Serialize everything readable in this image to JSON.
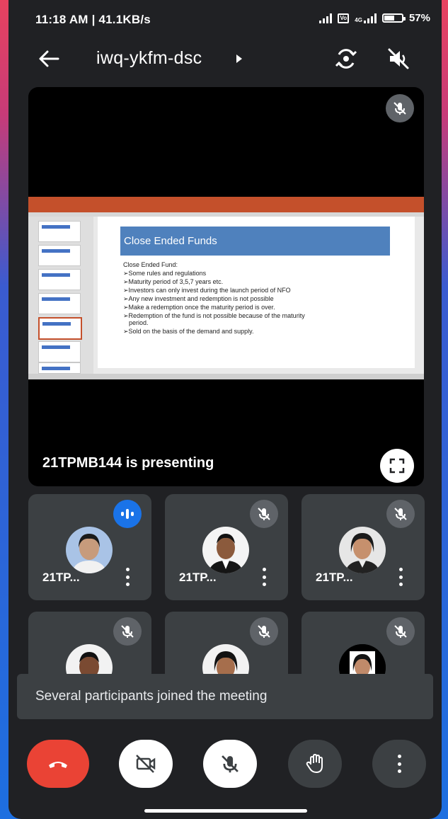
{
  "status_bar": {
    "time": "11:18 AM | 41.1KB/s",
    "battery": "57%",
    "network_label": "4G",
    "volte_label": "Vo"
  },
  "header": {
    "meeting_code": "iwq-ykfm-dsc",
    "icons": [
      "back-arrow-icon",
      "switch-camera-icon",
      "speaker-off-icon"
    ]
  },
  "presentation": {
    "presenting_text": "21TPMB144 is presenting",
    "slide": {
      "title": "Close Ended Funds",
      "subtitle": "Close Ended Fund:",
      "bullets": [
        "➢Some rules and regulations",
        "➢Maturity period of 3,5,7 years etc.",
        "➢Investors can only invest during the launch period of NFO",
        "➢Any new investment and redemption is not possible",
        "➢Make a redemption once the maturity period is over.",
        "➢Redemption of the fund is not possible because of the maturity",
        "period.",
        "➢Sold on the basis of the demand and supply."
      ]
    }
  },
  "participants": [
    {
      "name": "21TP...",
      "state": "speaking"
    },
    {
      "name": "21TP...",
      "state": "muted"
    },
    {
      "name": "21TP...",
      "state": "muted"
    },
    {
      "name": "",
      "state": "muted"
    },
    {
      "name": "",
      "state": "muted"
    },
    {
      "name": "",
      "state": "muted"
    }
  ],
  "toast": {
    "message": "Several participants joined the meeting"
  },
  "controls": {
    "end_call_color": "#ea4335",
    "icons": [
      "end-call-icon",
      "camera-off-icon",
      "mic-off-icon",
      "raise-hand-icon",
      "more-options-icon"
    ]
  },
  "colors": {
    "background": "#202124",
    "tile": "#3c4043",
    "accent": "#1a73e8",
    "end_call": "#ea4335"
  }
}
